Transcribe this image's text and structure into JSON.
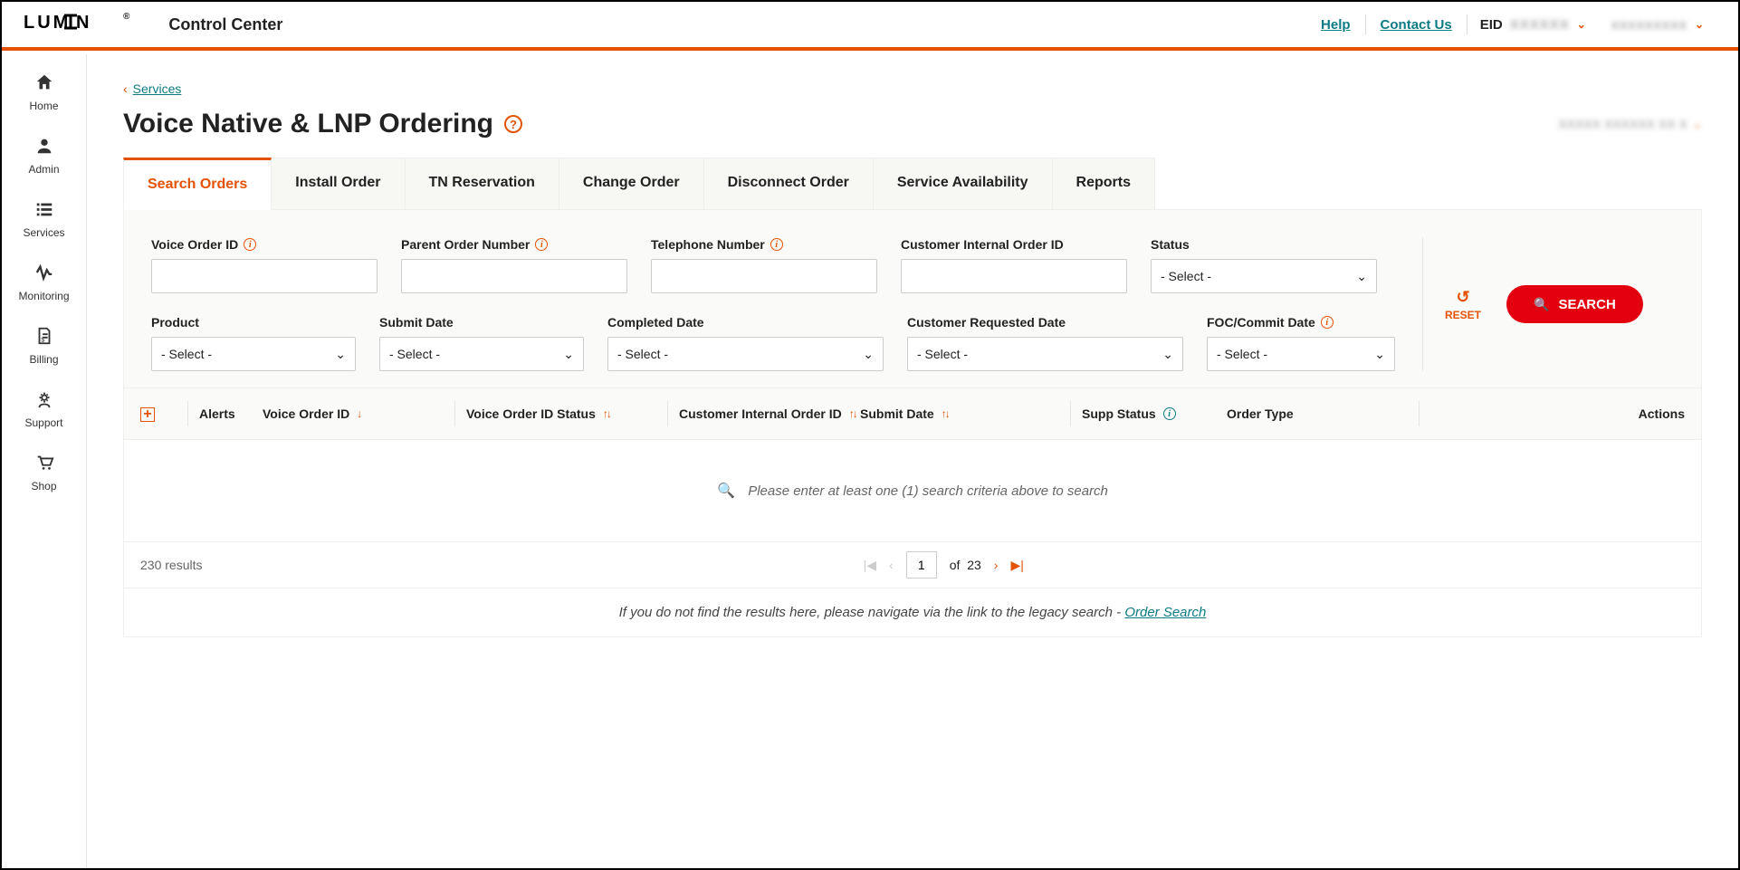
{
  "header": {
    "logo": "LUMEN",
    "logo_reg": "®",
    "app_title": "Control Center",
    "help": "Help",
    "contact": "Contact Us",
    "eid_label": "EID",
    "eid_value": "XXXXXX",
    "user_value": "xxxxxxxxx"
  },
  "sidebar": {
    "items": [
      {
        "label": "Home"
      },
      {
        "label": "Admin"
      },
      {
        "label": "Services"
      },
      {
        "label": "Monitoring"
      },
      {
        "label": "Billing"
      },
      {
        "label": "Support"
      },
      {
        "label": "Shop"
      }
    ]
  },
  "breadcrumb": {
    "back": "Services"
  },
  "page": {
    "title": "Voice Native & LNP Ordering",
    "account": "XXXXX XXXXXX XX X"
  },
  "tabs": [
    {
      "label": "Search Orders",
      "active": true
    },
    {
      "label": "Install Order"
    },
    {
      "label": "TN Reservation"
    },
    {
      "label": "Change Order"
    },
    {
      "label": "Disconnect Order"
    },
    {
      "label": "Service Availability"
    },
    {
      "label": "Reports"
    }
  ],
  "filters": {
    "voice_order_id": {
      "label": "Voice Order ID",
      "value": ""
    },
    "parent_order": {
      "label": "Parent Order Number",
      "value": ""
    },
    "telephone": {
      "label": "Telephone Number",
      "value": ""
    },
    "cust_internal_id": {
      "label": "Customer Internal Order ID",
      "value": ""
    },
    "status": {
      "label": "Status",
      "placeholder": "- Select -"
    },
    "product": {
      "label": "Product",
      "placeholder": "- Select -"
    },
    "submit_date": {
      "label": "Submit Date",
      "placeholder": "- Select -"
    },
    "completed_date": {
      "label": "Completed Date",
      "placeholder": "- Select -"
    },
    "cust_req_date": {
      "label": "Customer Requested Date",
      "placeholder": "- Select -"
    },
    "foc_date": {
      "label": "FOC/Commit Date",
      "placeholder": "- Select -"
    }
  },
  "buttons": {
    "reset": "RESET",
    "search": "SEARCH"
  },
  "table": {
    "columns": {
      "alerts": "Alerts",
      "voice_order_id": "Voice Order ID",
      "voice_status": "Voice Order ID Status",
      "cust_internal": "Customer Internal Order ID",
      "submit_date": "Submit Date",
      "supp_status": "Supp Status",
      "order_type": "Order Type",
      "actions": "Actions"
    },
    "empty": "Please enter at least one (1) search criteria above to search"
  },
  "pagination": {
    "results": "230 results",
    "page": "1",
    "of": "of",
    "total": "23"
  },
  "legacy": {
    "text": "If you do not find the results here, please navigate via the link to the legacy search - ",
    "link": "Order Search"
  }
}
